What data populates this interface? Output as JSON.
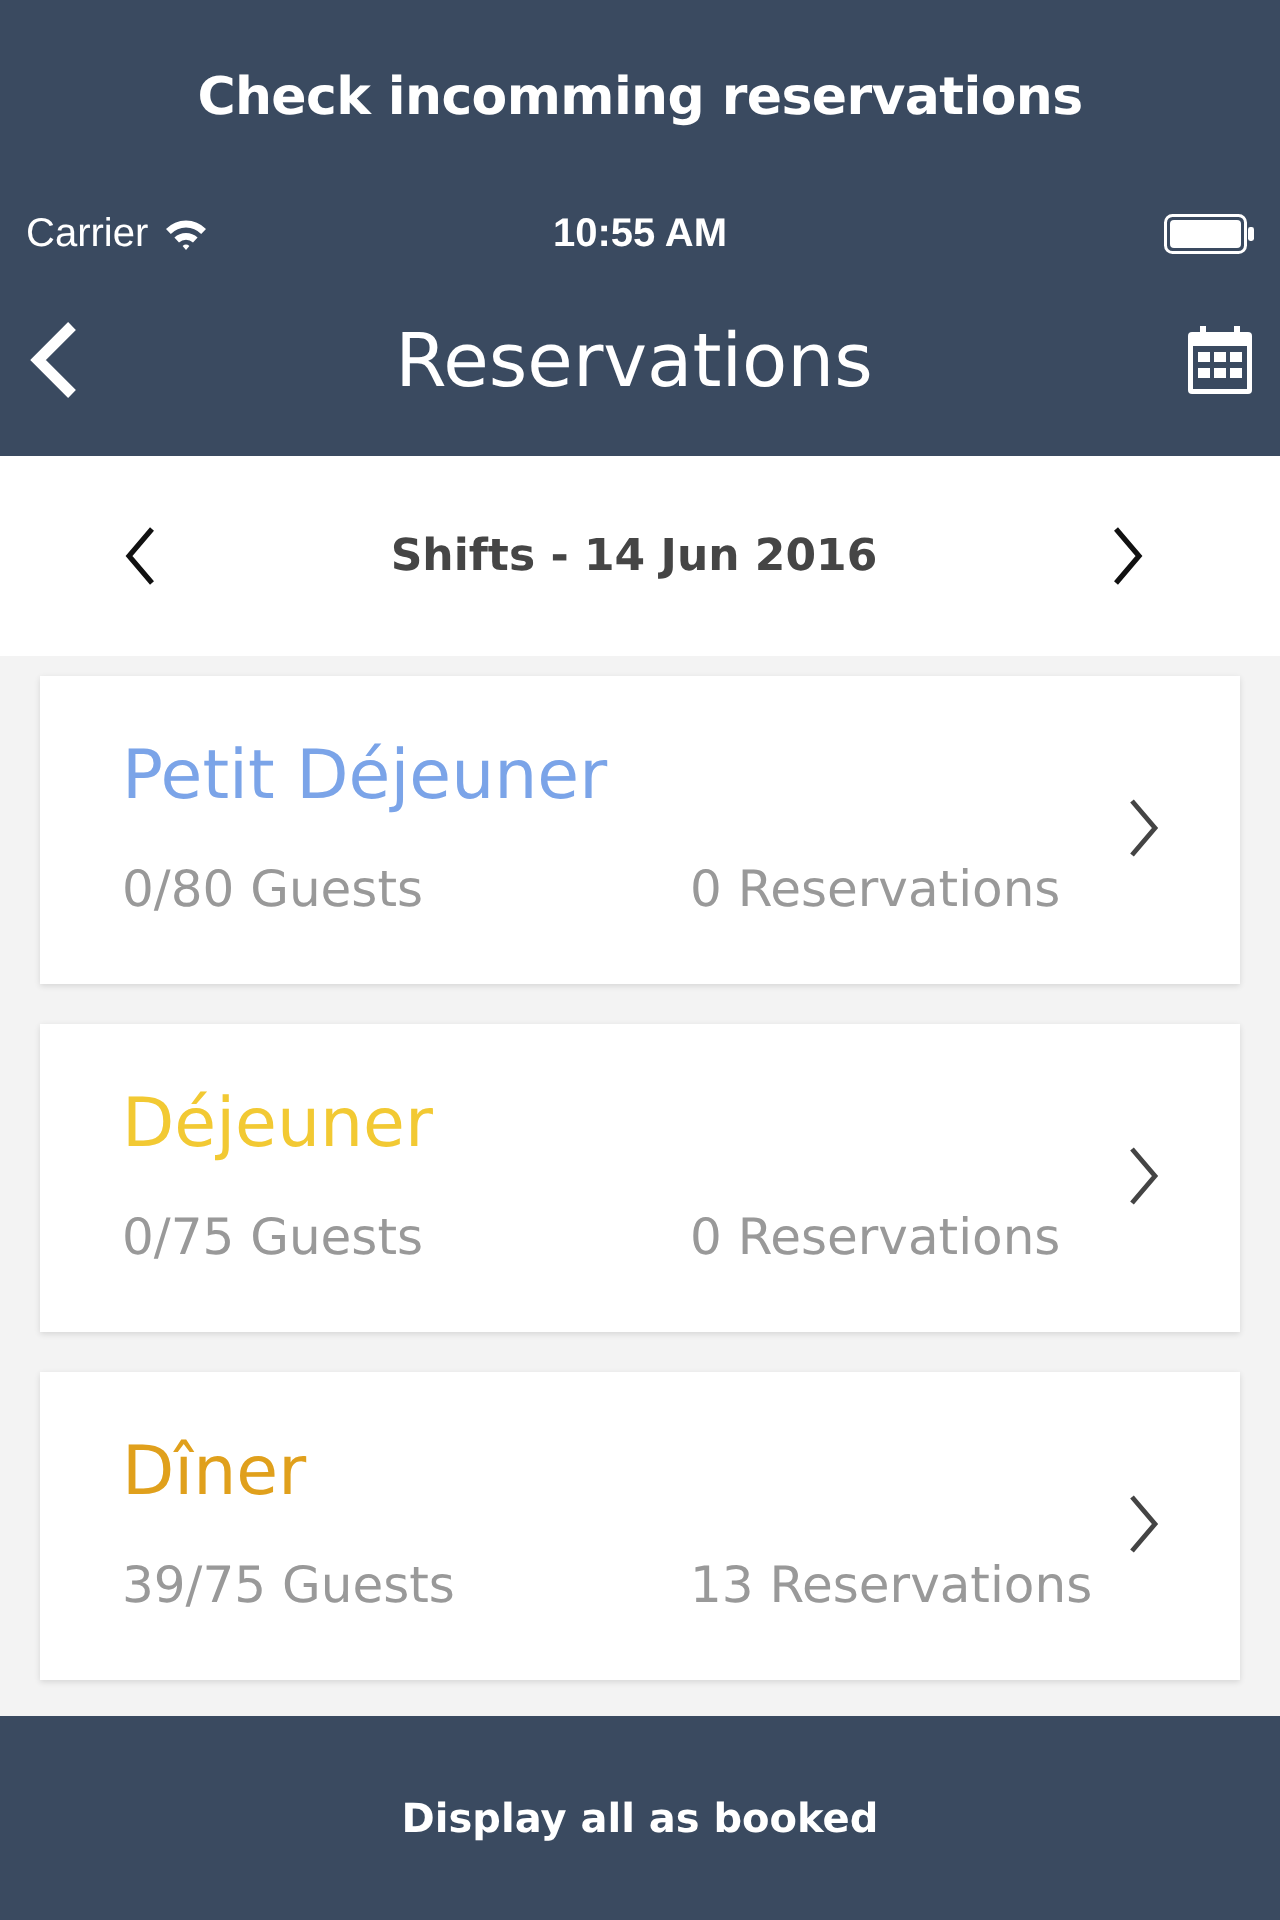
{
  "banner": {
    "title": "Check incomming reservations"
  },
  "status_bar": {
    "carrier": "Carrier",
    "time": "10:55 AM"
  },
  "nav_bar": {
    "title": "Reservations"
  },
  "date_bar": {
    "label": "Shifts - 14 Jun 2016"
  },
  "shifts": [
    {
      "name": "Petit Déjeuner",
      "color": "#7ba4e8",
      "guests": "0/80 Guests",
      "reservations": "0 Reservations"
    },
    {
      "name": "Déjeuner",
      "color": "#f2c933",
      "guests": "0/75 Guests",
      "reservations": "0 Reservations"
    },
    {
      "name": "Dîner",
      "color": "#e0a01c",
      "guests": "39/75 Guests",
      "reservations": "13 Reservations"
    }
  ],
  "footer_button": {
    "label": "Display all as booked"
  }
}
